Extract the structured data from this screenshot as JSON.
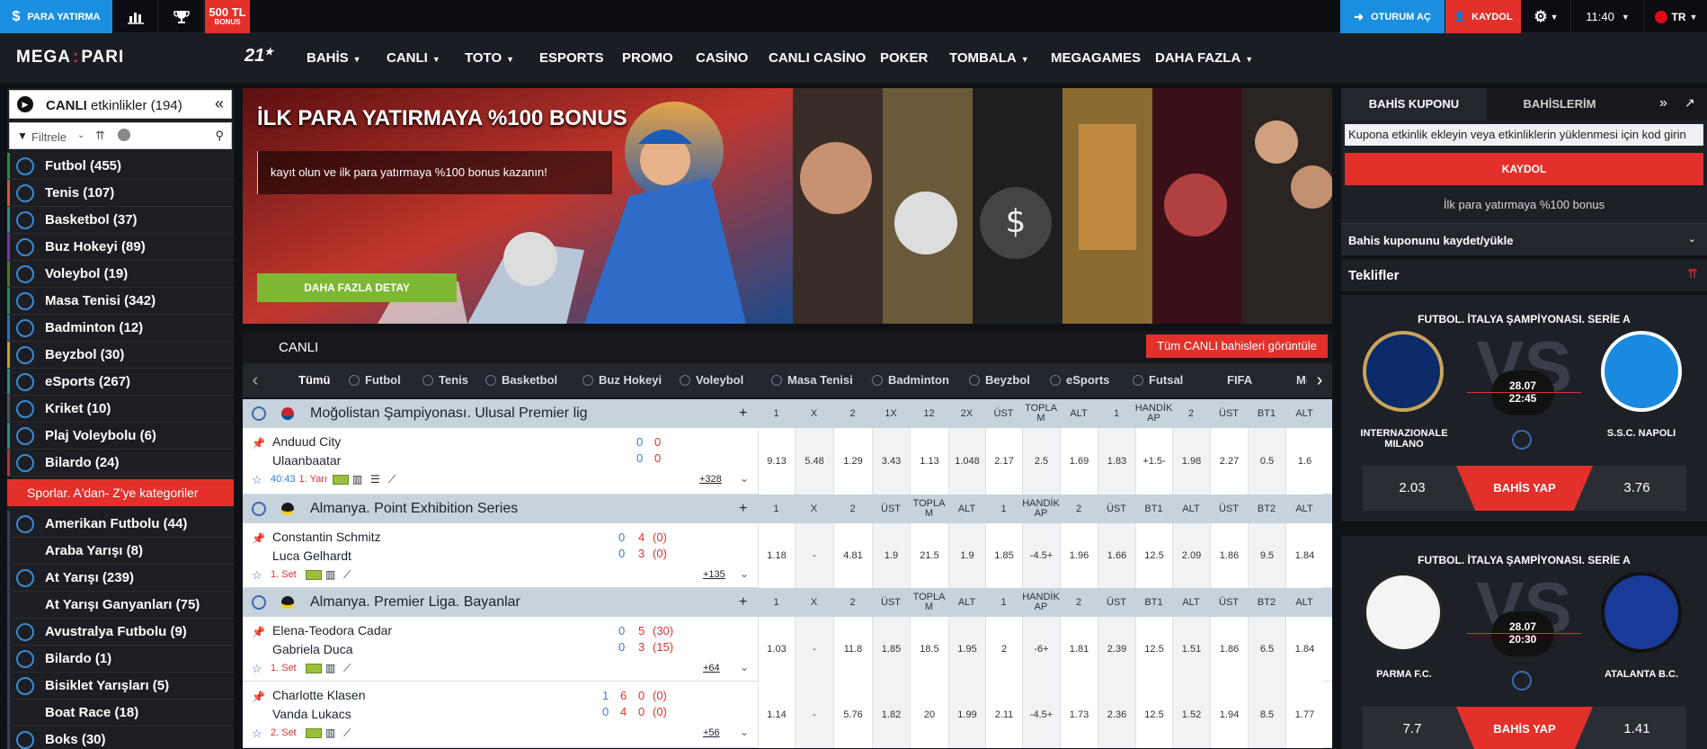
{
  "topbar": {
    "deposit": "PARA YATIRMA",
    "bonus_line1": "500 TL",
    "bonus_line2": "BONUS",
    "login": "OTURUM AÇ",
    "register": "KAYDOL",
    "time": "11:40",
    "lang": "TR"
  },
  "nav": {
    "logo_left": "MEGA",
    "logo_right": "PARI",
    "badge": "21",
    "items": [
      "BAHİS",
      "CANLI",
      "TOTO",
      "ESPORTS",
      "PROMO",
      "CASİNO",
      "CANLI CASİNO",
      "POKER",
      "TOMBALA",
      "MEGAGAMES",
      "DAHA FAZLA"
    ]
  },
  "left": {
    "header_bold": "CANLI",
    "header_rest": "etkinlikler (194)",
    "filter_label": "Filtrele",
    "sports": [
      "Futbol (455)",
      "Tenis (107)",
      "Basketbol (37)",
      "Buz Hokeyi (89)",
      "Voleybol (19)",
      "Masa Tenisi (342)",
      "Badminton (12)",
      "Beyzbol (30)",
      "eSports (267)",
      "Kriket (10)",
      "Plaj Voleybolu (6)",
      "Bilardo (24)"
    ],
    "category_button": "Sporlar. A'dan- Z'ye kategoriler",
    "sports2": [
      "Amerikan Futbolu (44)",
      "Araba Yarışı (8)",
      "At Yarışı (239)",
      "At Yarışı Ganyanları (75)",
      "Avustralya Futbolu (9)",
      "Bilardo (1)",
      "Bisiklet Yarışları (5)",
      "Boat Race (18)",
      "Boks (30)"
    ]
  },
  "banner": {
    "title": "İLK PARA YATIRMAYA %100 BONUS",
    "subtitle": "kayıt olun ve ilk para yatırmaya %100 bonus kazanın!",
    "button": "DAHA FAZLA DETAY"
  },
  "live": {
    "title": "CANLI",
    "view_all": "Tüm CANLI bahisleri görüntüle",
    "tabs": [
      "Tümü",
      "Futbol",
      "Tenis",
      "Basketbol",
      "Buz Hokeyi",
      "Voleybol",
      "Masa Tenisi",
      "Badminton",
      "Beyzbol",
      "eSports",
      "Futsal",
      "FIFA",
      "Mot"
    ]
  },
  "leagues": [
    {
      "name": "Moğolistan Şampiyonası. Ulusal Premier lig",
      "plus": "+",
      "cols": [
        "1",
        "X",
        "2",
        "1X",
        "12",
        "2X",
        "ÜST",
        "TOPLA M",
        "ALT",
        "1",
        "HANDİK AP",
        "2",
        "ÜST",
        "BT1",
        "ALT"
      ],
      "matches": [
        {
          "team1": "Anduud City",
          "team2": "Ulaanbaatar",
          "s1": [
            "0",
            "0"
          ],
          "s2": [
            "0",
            "0"
          ],
          "time": "40:43",
          "period": "1. Yarı",
          "more": "+328",
          "odds": [
            "9.13",
            "5.48",
            "1.29",
            "3.43",
            "1.13",
            "1.048",
            "2.17",
            "2.5",
            "1.69",
            "1.83",
            "+1.5-",
            "1.98",
            "2.27",
            "0.5",
            "1.6"
          ]
        }
      ]
    },
    {
      "name": "Almanya. Point Exhibition Series",
      "plus": "+",
      "cols": [
        "1",
        "X",
        "2",
        "ÜST",
        "TOPLA M",
        "ALT",
        "1",
        "HANDİK AP",
        "2",
        "ÜST",
        "BT1",
        "ALT",
        "ÜST",
        "BT2",
        "ALT"
      ],
      "matches": [
        {
          "team1": "Constantin Schmitz",
          "team2": "Luca Gelhardt",
          "s1": [
            "0",
            "4",
            "(0)"
          ],
          "s2": [
            "0",
            "3",
            "(0)"
          ],
          "time": "",
          "period": "1. Set",
          "more": "+135",
          "odds": [
            "1.18",
            "-",
            "4.81",
            "1.9",
            "21.5",
            "1.9",
            "1.85",
            "-4.5+",
            "1.96",
            "1.66",
            "12.5",
            "2.09",
            "1.86",
            "9.5",
            "1.84"
          ]
        }
      ]
    },
    {
      "name": "Almanya. Premier Liga. Bayanlar",
      "plus": "+",
      "cols": [
        "1",
        "X",
        "2",
        "ÜST",
        "TOPLA M",
        "ALT",
        "1",
        "HANDİK AP",
        "2",
        "ÜST",
        "BT1",
        "ALT",
        "ÜST",
        "BT2",
        "ALT"
      ],
      "matches": [
        {
          "team1": "Elena-Teodora Cadar",
          "team2": "Gabriela Duca",
          "s1": [
            "0",
            "5",
            "(30)"
          ],
          "s2": [
            "0",
            "3",
            "(15)"
          ],
          "time": "",
          "period": "1. Set",
          "more": "+64",
          "odds": [
            "1.03",
            "-",
            "11.8",
            "1.85",
            "18.5",
            "1.95",
            "2",
            "-6+",
            "1.81",
            "2.39",
            "12.5",
            "1.51",
            "1.86",
            "6.5",
            "1.84"
          ]
        },
        {
          "team1": "Charlotte Klasen",
          "team2": "Vanda Lukacs",
          "s1": [
            "1",
            "6",
            "0",
            "(0)"
          ],
          "s2": [
            "0",
            "4",
            "0",
            "(0)"
          ],
          "time": "",
          "period": "2. Set",
          "more": "+56",
          "odds": [
            "1.14",
            "-",
            "5.76",
            "1.82",
            "20",
            "1.99",
            "2.11",
            "-4.5+",
            "1.73",
            "2.36",
            "12.5",
            "1.52",
            "1.94",
            "8.5",
            "1.77"
          ]
        }
      ]
    }
  ],
  "coupon": {
    "tab1": "BAHİS KUPONU",
    "tab2": "BAHİSLERİM",
    "input_placeholder": "Kupona etkinlik ekleyin veya etkinliklerin yüklenmesi için kod girin",
    "register": "KAYDOL",
    "bonus": "İlk para yatırmaya %100 bonus",
    "save_load": "Bahis kuponunu kaydet/yükle"
  },
  "offers": {
    "title": "Teklifler",
    "vs": "VS",
    "cta": "BAHİS YAP",
    "items": [
      {
        "league": "FUTBOL. İTALYA ŞAMPİYONASI. SERİE A",
        "date": "28.07",
        "time": "22:45",
        "team1": "INTERNAZIONALE MILANO",
        "team2": "S.S.C. NAPOLI",
        "odd1": "2.03",
        "odd2": "3.76"
      },
      {
        "league": "FUTBOL. İTALYA ŞAMPİYONASI. SERİE A",
        "date": "28.07",
        "time": "20:30",
        "team1": "PARMA F.C.",
        "team2": "ATALANTA B.C.",
        "odd1": "7.7",
        "odd2": "1.41"
      }
    ]
  },
  "colors": {
    "accent": "#e4302b",
    "deposit": "#1a8fe0",
    "green": "#7cb832",
    "league_header": "#c7d3dc"
  }
}
